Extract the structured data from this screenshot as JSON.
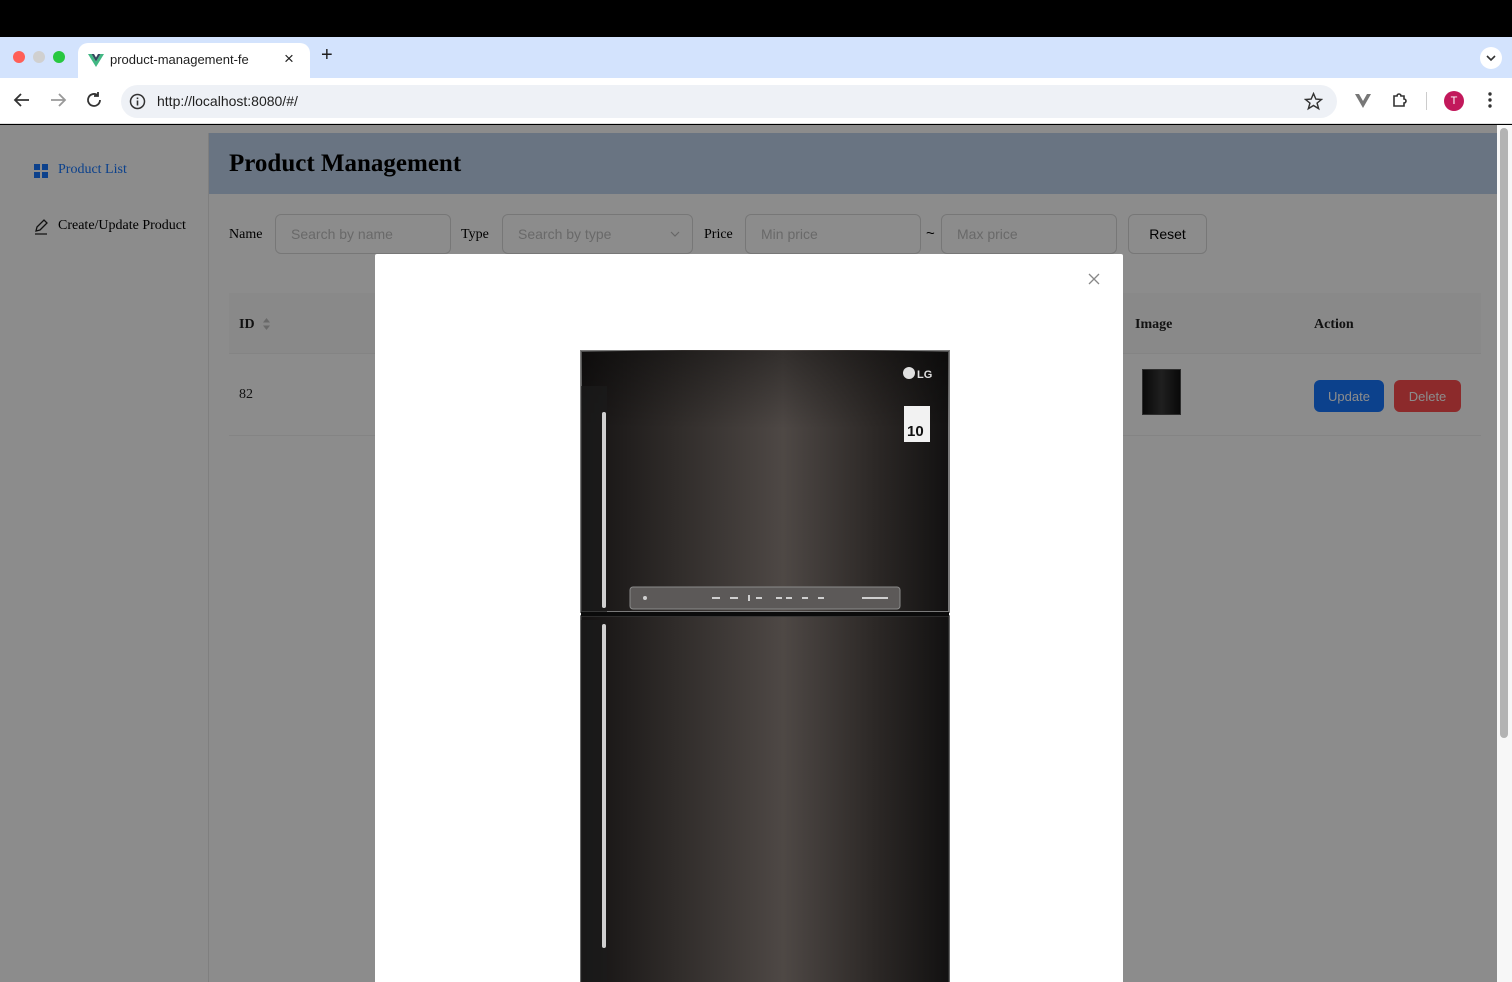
{
  "browser": {
    "tab_title": "product-management-fe",
    "new_tab_symbol": "+",
    "tab_close_symbol": "×",
    "url": "http://localhost:8080/#/",
    "profile_initial": "T"
  },
  "sidebar": {
    "items": [
      {
        "label": "Product List",
        "icon": "grid-icon",
        "active": true
      },
      {
        "label": "Create/Update Product",
        "icon": "edit-icon",
        "active": false
      }
    ]
  },
  "header": {
    "title": "Product Management"
  },
  "filters": {
    "name_label": "Name",
    "name_placeholder": "Search by name",
    "type_label": "Type",
    "type_placeholder": "Search by type",
    "price_label": "Price",
    "min_placeholder": "Min price",
    "range_separator": "~",
    "max_placeholder": "Max price",
    "reset_label": "Reset"
  },
  "table": {
    "columns": [
      "ID",
      "Image",
      "Action"
    ],
    "rows": [
      {
        "id": "82",
        "update_label": "Update",
        "delete_label": "Delete"
      }
    ]
  },
  "modal": {
    "image_alt": "LG refrigerator",
    "brand_mark": "LG",
    "badge_number": "10"
  },
  "colors": {
    "primary": "#1677ff",
    "danger": "#ff4d4f",
    "header_bg": "#bfd4ed",
    "tabstrip_bg": "#d3e3fd"
  }
}
